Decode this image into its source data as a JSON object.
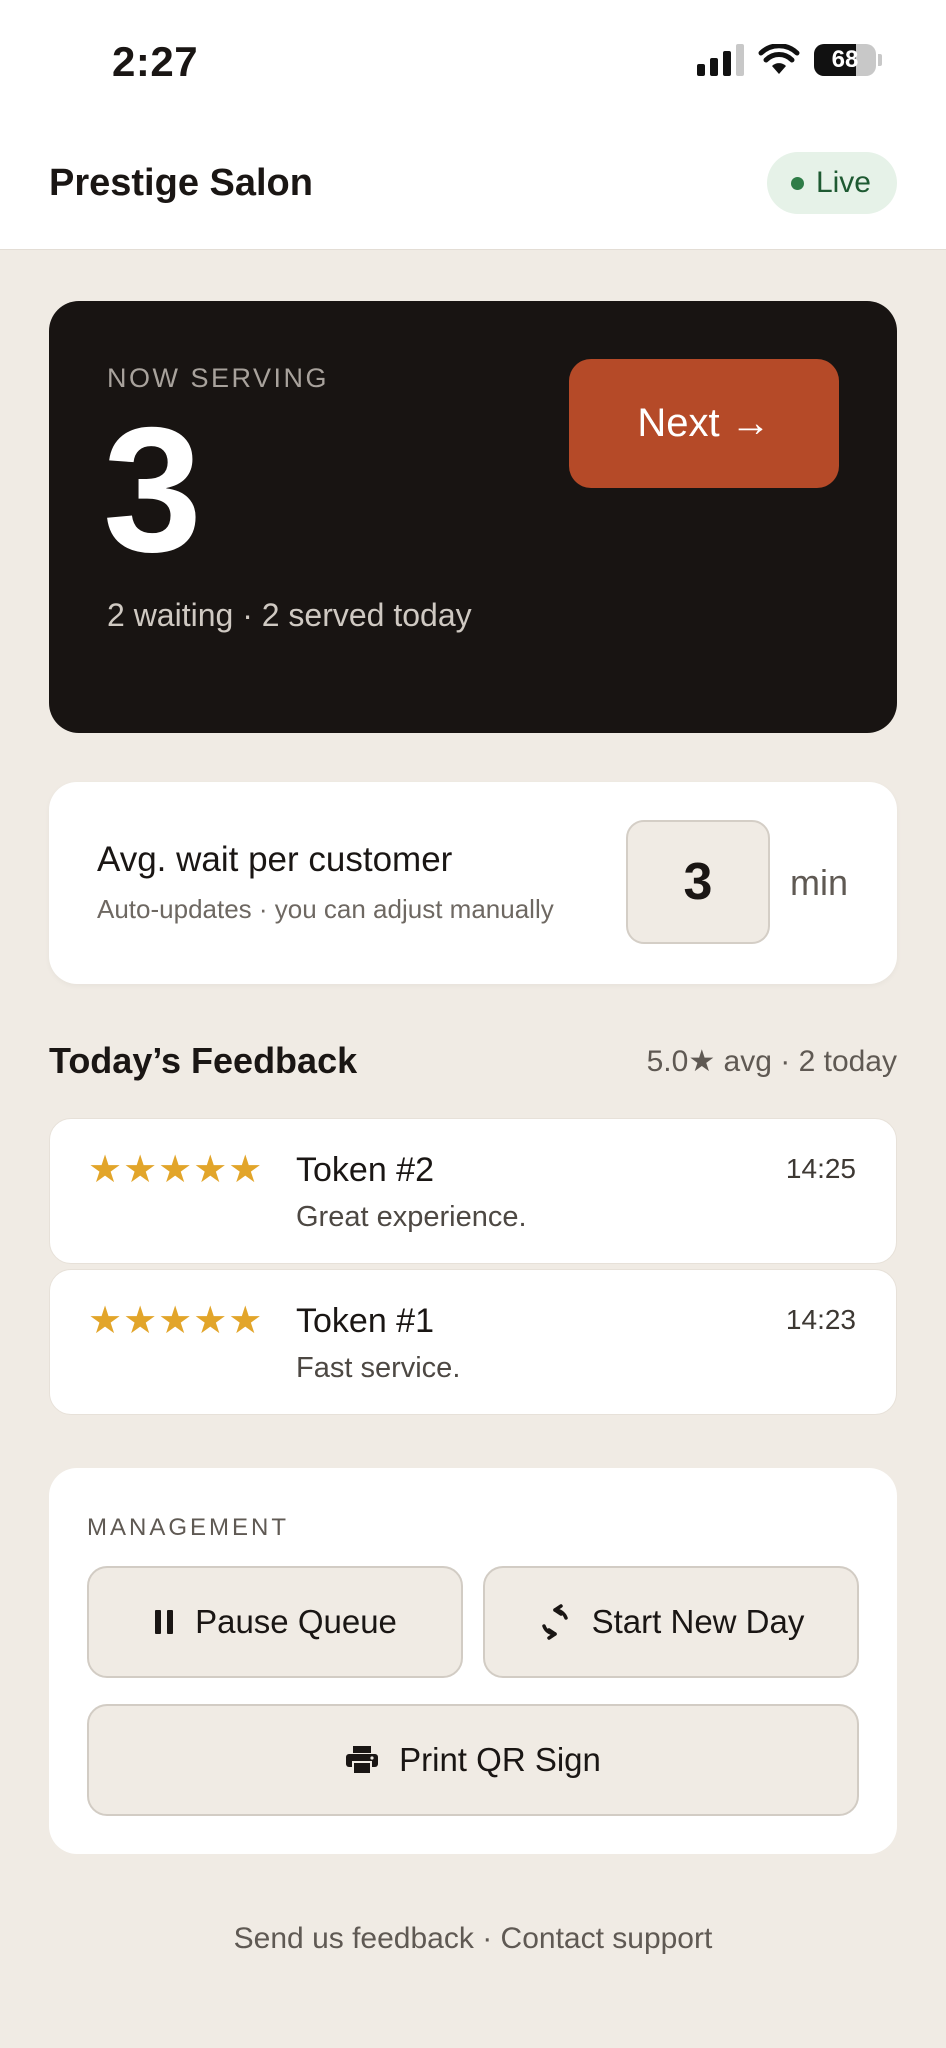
{
  "status": {
    "time": "2:27",
    "battery": "68",
    "battery_level": 0.68
  },
  "header": {
    "title": "Prestige Salon",
    "badge": "Live"
  },
  "now_serving": {
    "label": "NOW SERVING",
    "number": "3",
    "summary": "2 waiting · 2 served today",
    "next_label": "Next →"
  },
  "wait": {
    "title": "Avg. wait per customer",
    "subtitle": "Auto-updates · you can adjust manually",
    "value": "3",
    "unit": "min"
  },
  "feedback": {
    "title": "Today’s Feedback",
    "summary": "5.0★ avg · 2 today",
    "items": [
      {
        "stars": "★★★★★",
        "token": "Token #2",
        "comment": "Great experience.",
        "time": "14:25"
      },
      {
        "stars": "★★★★★",
        "token": "Token #1",
        "comment": "Fast service.",
        "time": "14:23"
      }
    ]
  },
  "management": {
    "label": "MANAGEMENT",
    "pause_label": "Pause Queue",
    "new_day_label": "Start New Day",
    "print_label": "Print QR Sign"
  },
  "footer": {
    "feedback_link": "Send us feedback",
    "separator": " · ",
    "support_link": "Contact support"
  },
  "colors": {
    "accent": "#b54a28",
    "dark_card": "#181412",
    "star": "#e2a52a",
    "live": "#2f7d47",
    "background": "#f0ebe4"
  }
}
